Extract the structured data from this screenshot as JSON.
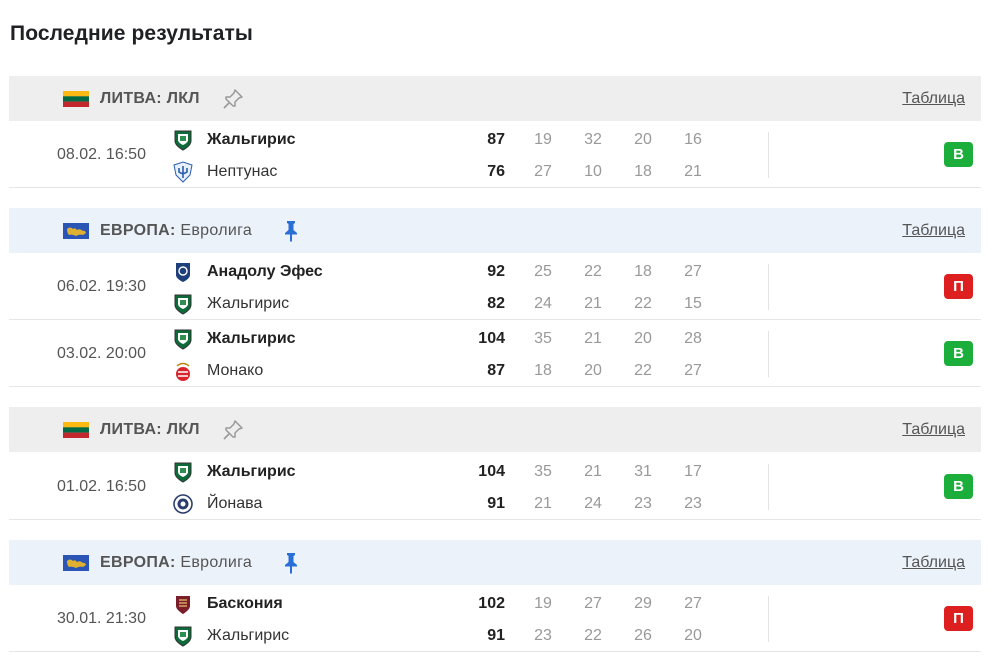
{
  "page": {
    "title": "Последние результаты"
  },
  "colors": {
    "win": "#1cae3a",
    "loss": "#dd1f1f",
    "pin_active": "#2a6fd6"
  },
  "groups": [
    {
      "league_country": "ЛИТВА:",
      "league_name": "ЛКЛ",
      "pinned": false,
      "flag": "lithuania-flag",
      "table_link": "Таблица",
      "matches": [
        {
          "date": "08.02. 16:50",
          "home": {
            "name": "Жальгирис",
            "logo": "zalgiris-logo",
            "winner": true,
            "score": "87",
            "quarters": [
              "19",
              "32",
              "20",
              "16"
            ]
          },
          "away": {
            "name": "Нептунас",
            "logo": "neptunas-logo",
            "winner": false,
            "score": "76",
            "quarters": [
              "27",
              "10",
              "18",
              "21"
            ]
          },
          "result": "В",
          "result_type": "win"
        }
      ]
    },
    {
      "league_country": "ЕВРОПА:",
      "league_name": "Евролига",
      "pinned": true,
      "flag": "europe-flag",
      "table_link": "Таблица",
      "matches": [
        {
          "date": "06.02. 19:30",
          "home": {
            "name": "Анадолу Эфес",
            "logo": "anadolu-efes-logo",
            "winner": true,
            "score": "92",
            "quarters": [
              "25",
              "22",
              "18",
              "27"
            ]
          },
          "away": {
            "name": "Жальгирис",
            "logo": "zalgiris-logo",
            "winner": false,
            "score": "82",
            "quarters": [
              "24",
              "21",
              "22",
              "15"
            ]
          },
          "result": "П",
          "result_type": "loss"
        },
        {
          "date": "03.02. 20:00",
          "home": {
            "name": "Жальгирис",
            "logo": "zalgiris-logo",
            "winner": true,
            "score": "104",
            "quarters": [
              "35",
              "21",
              "20",
              "28"
            ]
          },
          "away": {
            "name": "Монако",
            "logo": "monaco-logo",
            "winner": false,
            "score": "87",
            "quarters": [
              "18",
              "20",
              "22",
              "27"
            ]
          },
          "result": "В",
          "result_type": "win"
        }
      ]
    },
    {
      "league_country": "ЛИТВА:",
      "league_name": "ЛКЛ",
      "pinned": false,
      "flag": "lithuania-flag",
      "table_link": "Таблица",
      "matches": [
        {
          "date": "01.02. 16:50",
          "home": {
            "name": "Жальгирис",
            "logo": "zalgiris-logo",
            "winner": true,
            "score": "104",
            "quarters": [
              "35",
              "21",
              "31",
              "17"
            ]
          },
          "away": {
            "name": "Йонава",
            "logo": "jonava-logo",
            "winner": false,
            "score": "91",
            "quarters": [
              "21",
              "24",
              "23",
              "23"
            ]
          },
          "result": "В",
          "result_type": "win"
        }
      ]
    },
    {
      "league_country": "ЕВРОПА:",
      "league_name": "Евролига",
      "pinned": true,
      "flag": "europe-flag",
      "table_link": "Таблица",
      "matches": [
        {
          "date": "30.01. 21:30",
          "home": {
            "name": "Баскония",
            "logo": "baskonia-logo",
            "winner": true,
            "score": "102",
            "quarters": [
              "19",
              "27",
              "29",
              "27"
            ]
          },
          "away": {
            "name": "Жальгирис",
            "logo": "zalgiris-logo",
            "winner": false,
            "score": "91",
            "quarters": [
              "23",
              "22",
              "26",
              "20"
            ]
          },
          "result": "П",
          "result_type": "loss"
        }
      ]
    }
  ]
}
